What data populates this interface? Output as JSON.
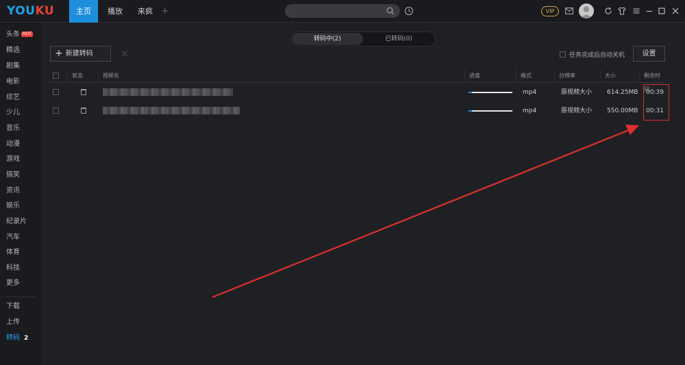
{
  "app": {
    "logo_part1": "YOU",
    "logo_part2": "KU"
  },
  "nav": {
    "tabs": [
      "主页",
      "播放",
      "来疯"
    ],
    "add_label": "+",
    "vip_label": "VIP"
  },
  "sidebar": {
    "items": [
      {
        "label": "头条",
        "badge": "HOT"
      },
      {
        "label": "精选"
      },
      {
        "label": "剧集"
      },
      {
        "label": "电影"
      },
      {
        "label": "综艺"
      },
      {
        "label": "少儿"
      },
      {
        "label": "音乐"
      },
      {
        "label": "动漫"
      },
      {
        "label": "游戏"
      },
      {
        "label": "搞笑"
      },
      {
        "label": "资讯"
      },
      {
        "label": "娱乐"
      },
      {
        "label": "纪录片"
      },
      {
        "label": "汽车"
      },
      {
        "label": "体育"
      },
      {
        "label": "科技"
      },
      {
        "label": "更多"
      }
    ],
    "bottom_items": [
      {
        "label": "下载"
      },
      {
        "label": "上传"
      },
      {
        "label": "转码",
        "count": "2"
      }
    ]
  },
  "toolbar": {
    "seg_converting": "转码中(2)",
    "seg_converted": "已转码(0)",
    "new_convert_label": "新建转码",
    "auto_shutdown_label": "任务完成后自动关机",
    "settings_label": "设置"
  },
  "table": {
    "headers": {
      "status": "状态",
      "name": "视频名",
      "progress": "进度",
      "format": "格式",
      "resolution": "分辨率",
      "size": "大小",
      "remaining": "剩余时间"
    },
    "rows": [
      {
        "format": "mp4",
        "resolution": "原视频大小",
        "size": "614.25MB",
        "remaining": "00:39",
        "progress": 0.08
      },
      {
        "format": "mp4",
        "resolution": "原视频大小",
        "size": "550.00MB",
        "remaining": "00:31",
        "progress": 0.08
      }
    ]
  },
  "colors": {
    "accent": "#1e8fdc",
    "annotation": "#e0302e"
  }
}
